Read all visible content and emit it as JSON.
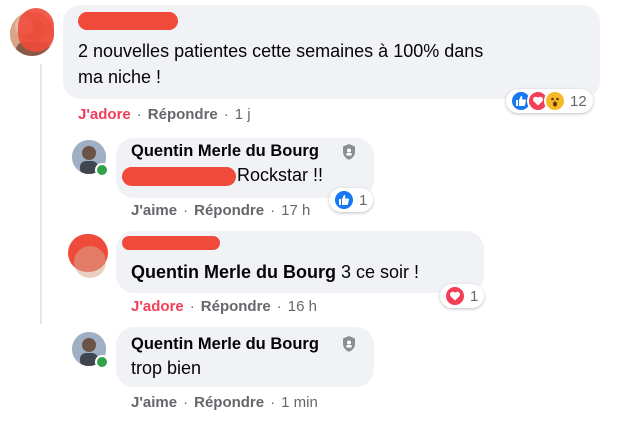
{
  "comments": [
    {
      "author": "",
      "text_lines": [
        "2 nouvelles patientes cette semaines à 100% dans",
        "ma niche !"
      ],
      "actions": {
        "primary": "J'adore",
        "reply": "Répondre",
        "time": "1 j"
      },
      "reactions": {
        "icons": [
          "like-icon",
          "love-icon",
          "wow-icon"
        ],
        "count": "12"
      }
    },
    {
      "author": "Quentin Merle du Bourg",
      "text": "Rockstar !!",
      "actions": {
        "primary": "J'aime",
        "reply": "Répondre",
        "time": "17 h"
      },
      "reactions": {
        "icons": [
          "like-icon"
        ],
        "count": "1"
      }
    },
    {
      "author": "",
      "mention": "Quentin Merle du Bourg",
      "text": " 3 ce soir !",
      "actions": {
        "primary": "J'adore",
        "reply": "Répondre",
        "time": "16 h"
      },
      "reactions": {
        "icons": [
          "love-icon"
        ],
        "count": "1"
      }
    },
    {
      "author": "Quentin Merle du Bourg",
      "text": "trop bien",
      "actions": {
        "primary": "J'aime",
        "reply": "Répondre",
        "time": "1 min"
      }
    }
  ],
  "colors": {
    "like": "#1877f2",
    "love": "#f33e58",
    "wow": "#f7b928",
    "redaction": "#ef4a3a",
    "bubble": "#f0f2f5",
    "online": "#31a24c"
  }
}
